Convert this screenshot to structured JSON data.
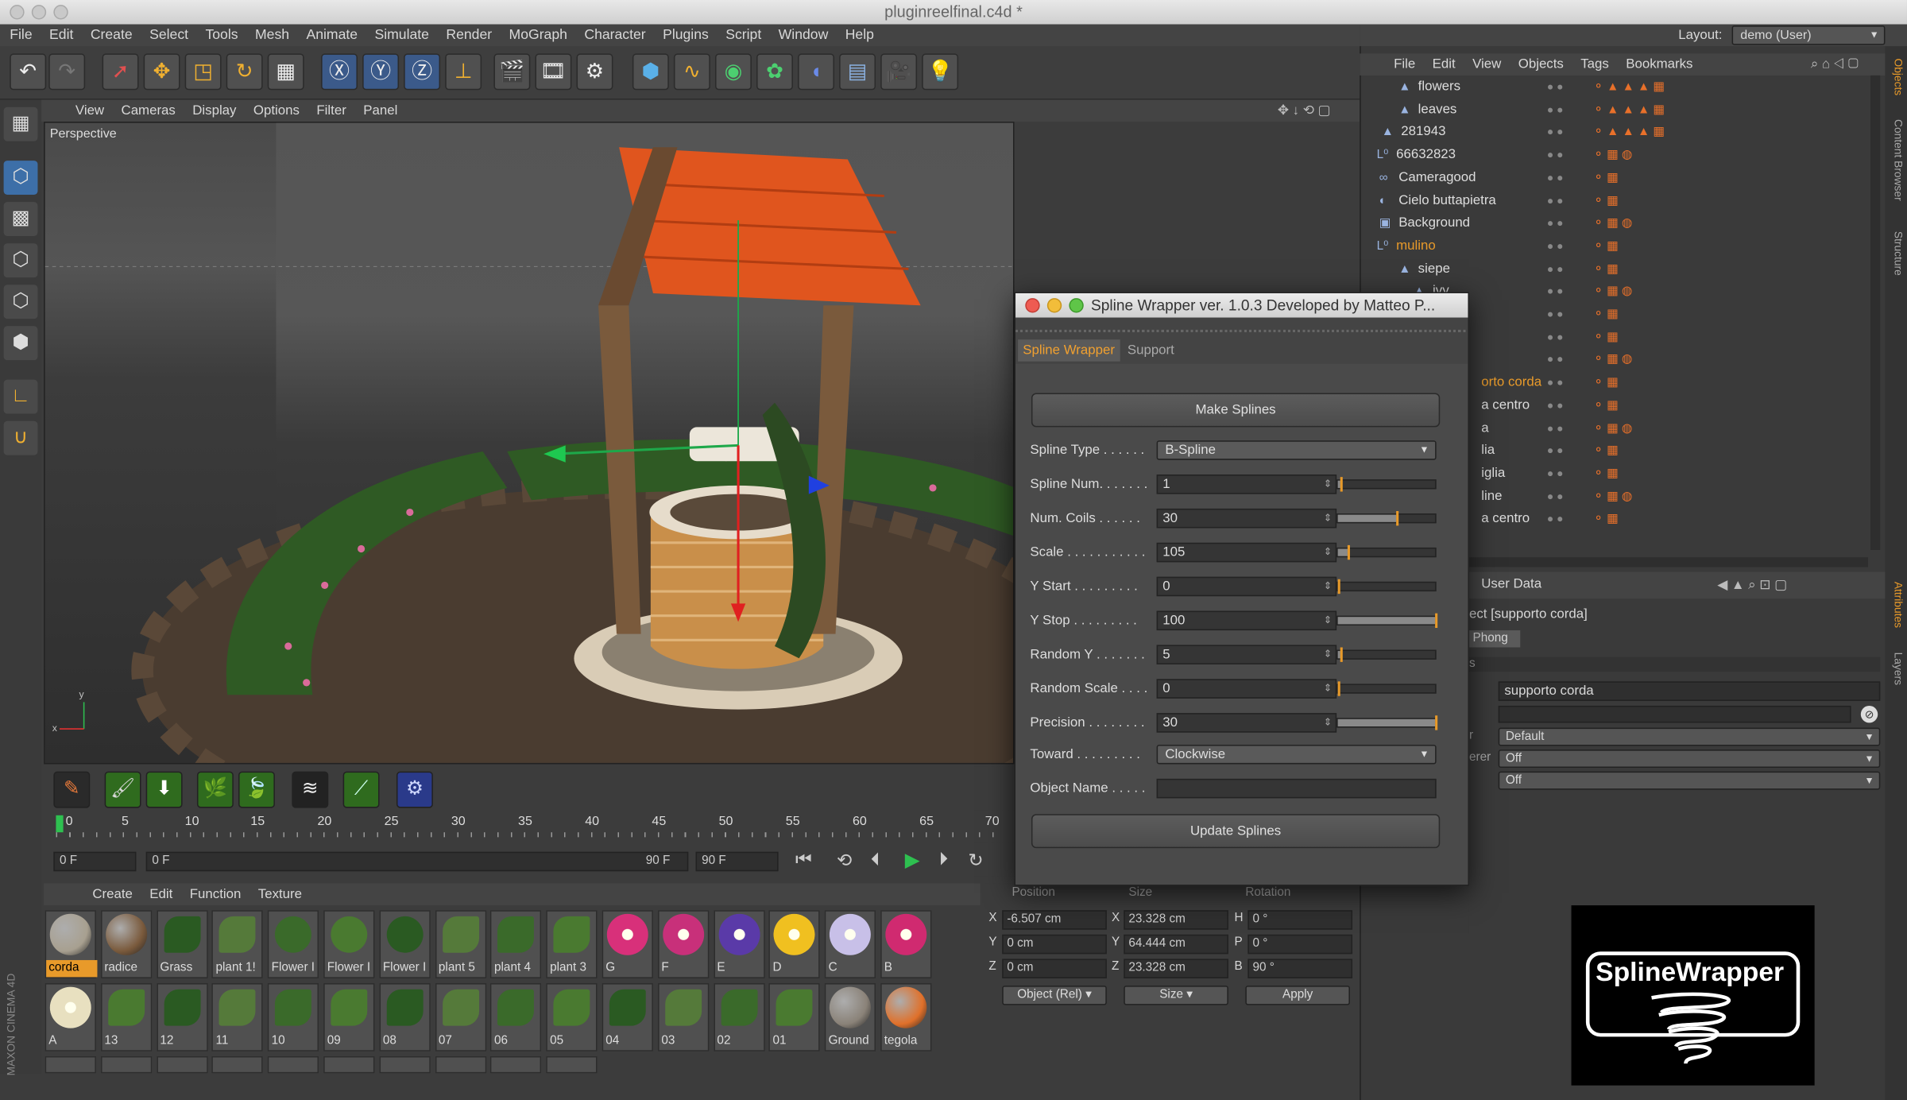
{
  "window": {
    "title": "pluginreelfinal.c4d *"
  },
  "menubar": [
    "File",
    "Edit",
    "Create",
    "Select",
    "Tools",
    "Mesh",
    "Animate",
    "Simulate",
    "Render",
    "MoGraph",
    "Character",
    "Plugins",
    "Script",
    "Window",
    "Help"
  ],
  "layout": {
    "label": "Layout:",
    "value": "demo (User)"
  },
  "viewport": {
    "menu": [
      "View",
      "Cameras",
      "Display",
      "Options",
      "Filter",
      "Panel"
    ],
    "label": "Perspective"
  },
  "timeline": {
    "ticks": [
      "0",
      "5",
      "10",
      "15",
      "20",
      "25",
      "30",
      "35",
      "40",
      "45",
      "50",
      "55",
      "60",
      "65",
      "70"
    ],
    "current": "0 F",
    "start": "0 F",
    "range_end": "90 F",
    "end": "90 F"
  },
  "materials": {
    "menu": [
      "Create",
      "Edit",
      "Function",
      "Texture"
    ],
    "row1": [
      "corda",
      "radice",
      "Grass",
      "plant 1!",
      "Flower I",
      "Flower I",
      "Flower I",
      "plant 5",
      "plant 4",
      "plant 3",
      "G",
      "F",
      "E",
      "D",
      "C",
      "B"
    ],
    "row2": [
      "A",
      "13",
      "12",
      "11",
      "10",
      "09",
      "08",
      "07",
      "06",
      "05",
      "04",
      "03",
      "02",
      "01",
      "Ground",
      "tegola"
    ]
  },
  "coords": {
    "headers": [
      "Position",
      "Size",
      "Rotation"
    ],
    "rows": [
      {
        "axis": "X",
        "pos": "-6.507 cm",
        "saxis": "X",
        "size": "23.328 cm",
        "raxis": "H",
        "rot": "0 °"
      },
      {
        "axis": "Y",
        "pos": "0 cm",
        "saxis": "Y",
        "size": "64.444 cm",
        "raxis": "P",
        "rot": "0 °"
      },
      {
        "axis": "Z",
        "pos": "0 cm",
        "saxis": "Z",
        "size": "23.328 cm",
        "raxis": "B",
        "rot": "90 °"
      }
    ],
    "mode": "Object (Rel)",
    "size_mode": "Size",
    "apply": "Apply"
  },
  "objects": {
    "menu": [
      "File",
      "Edit",
      "View",
      "Objects",
      "Tags",
      "Bookmarks"
    ],
    "rows": [
      "flowers",
      "leaves",
      "281943",
      "66632823",
      "Cameragood",
      "Cielo buttapietra",
      "Background",
      "mulino",
      "siepe",
      "ivy",
      "",
      "",
      "",
      "orto corda",
      "a centro",
      "a",
      "lia",
      "iglia",
      "line",
      "a centro"
    ]
  },
  "attributes": {
    "tab": "User Data",
    "object": "ect [supporto corda]",
    "phong": "Phong",
    "name_value": "supporto corda",
    "sel1": "Default",
    "sel2": "Off",
    "sel3": "Off",
    "lbl1": "r",
    "lbl2": "erer",
    "lbl3": "s"
  },
  "sidetabs": [
    "Objects",
    "Content Browser",
    "Structure",
    "Attributes",
    "Layers"
  ],
  "dialog": {
    "title": "Spline Wrapper ver. 1.0.3 Developed by Matteo P...",
    "tabs": [
      "Spline Wrapper",
      "Support"
    ],
    "make_button": "Make Splines",
    "update_button": "Update Splines",
    "params": [
      {
        "label": "Spline Type . . . . . .",
        "value": "B-Spline",
        "kind": "select"
      },
      {
        "label": "Spline Num. . . . . . .",
        "value": "1",
        "kind": "num",
        "fill": 0.02
      },
      {
        "label": "Num. Coils . . . . . .",
        "value": "30",
        "kind": "num",
        "fill": 0.6
      },
      {
        "label": "Scale . . . . . . . . . . .",
        "value": "105",
        "kind": "num",
        "fill": 0.1
      },
      {
        "label": "Y Start . . . . . . . . .",
        "value": "0",
        "kind": "num",
        "fill": 0.0
      },
      {
        "label": "Y Stop . . . . . . . . .",
        "value": "100",
        "kind": "num",
        "fill": 1.0
      },
      {
        "label": "Random Y . . . . . . .",
        "value": "5",
        "kind": "num",
        "fill": 0.02
      },
      {
        "label": "Random Scale . . . .",
        "value": "0",
        "kind": "num",
        "fill": 0.0
      },
      {
        "label": "Precision . . . . . . . .",
        "value": "30",
        "kind": "num",
        "fill": 1.0
      },
      {
        "label": "Toward . . . . . . . . .",
        "value": "Clockwise",
        "kind": "select"
      },
      {
        "label": "Object Name . . . . .",
        "value": "",
        "kind": "text"
      }
    ]
  },
  "brand": {
    "logo_text": "SplineWrapper",
    "vendor": "MAXON",
    "product": "CINEMA 4D"
  },
  "colors": {
    "accent": "#e89a2a",
    "roof": "#e0551e",
    "bush": "#2f5a24",
    "panel": "#3c3c3c"
  }
}
